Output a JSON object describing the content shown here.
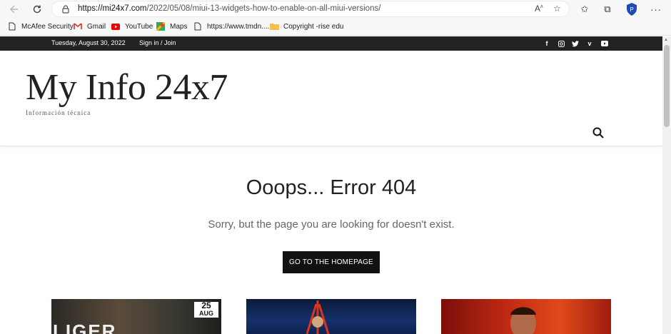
{
  "browser": {
    "url_host": "https://mi24x7.com",
    "url_path": "/2022/05/08/miui-13-widgets-how-to-enable-on-all-miui-versions/"
  },
  "bookmarks": [
    {
      "label": "McAfee Security",
      "icon": "document-icon"
    },
    {
      "label": "Gmail",
      "icon": "gmail-icon"
    },
    {
      "label": "YouTube",
      "icon": "youtube-icon"
    },
    {
      "label": "Maps",
      "icon": "maps-icon"
    },
    {
      "label": "https://www.tmdn....",
      "icon": "document-icon"
    },
    {
      "label": "Copyright -rise edu",
      "icon": "folder-icon"
    }
  ],
  "site": {
    "date": "Tuesday, August 30, 2022",
    "signin": "Sign in / Join",
    "social": [
      "facebook-icon",
      "instagram-icon",
      "twitter-icon",
      "vimeo-icon",
      "youtube-icon"
    ],
    "logo": "My Info 24x7",
    "tagline": "Información técnica"
  },
  "error": {
    "title": "Ooops... Error 404",
    "message": "Sorry, but the page you are looking for doesn't exist.",
    "button": "GO TO THE HOMEPAGE"
  },
  "thumbnails": [
    {
      "title": "LIGER",
      "date_day": "25",
      "date_month": "AUG"
    },
    {
      "title": ""
    },
    {
      "title": ""
    }
  ],
  "colors": {
    "topbar": "#222222",
    "button": "#111111",
    "profile": "#1e4bb8"
  }
}
